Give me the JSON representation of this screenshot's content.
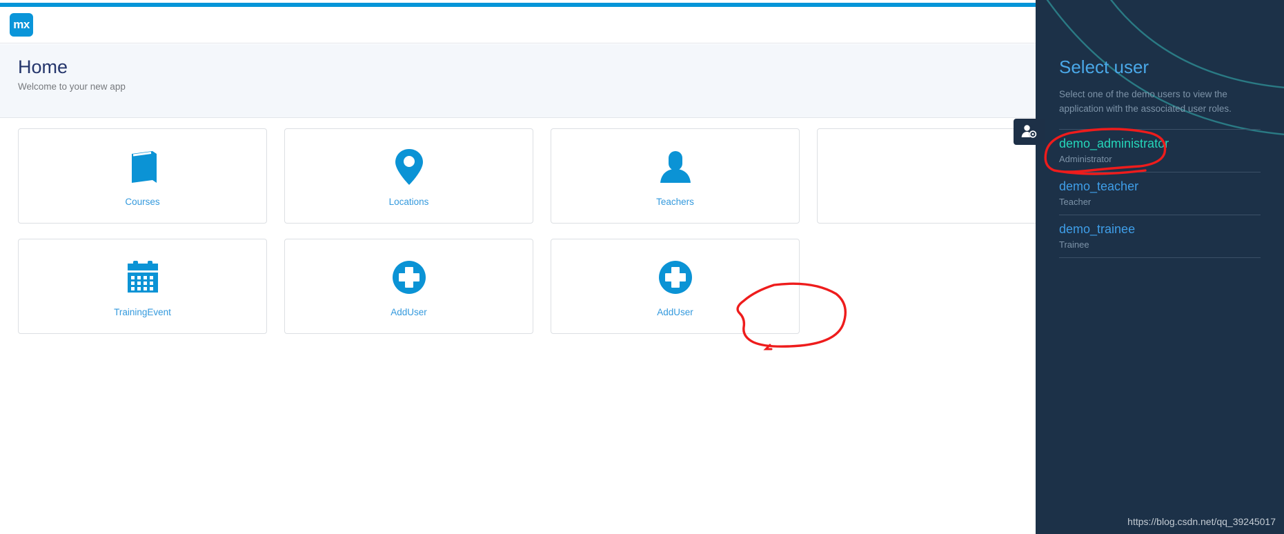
{
  "theme": {
    "accent_blue": "#0595d8",
    "tile_link_blue": "#3399dd",
    "sidebar_bg": "#1c3148",
    "sidebar_title_blue": "#4aa8e8",
    "active_user_teal": "#25d6ba",
    "annotation_red": "#ee1c1c",
    "page_title_navy": "#24356b"
  },
  "navbar": {
    "logo_text": "mx",
    "logo_icon": "mendix-logo-icon"
  },
  "header": {
    "title": "Home",
    "subtitle": "Welcome to your new app"
  },
  "user_tab": {
    "icon": "user-settings-icon",
    "label": ""
  },
  "tiles": {
    "row1": [
      {
        "label": "Courses",
        "icon": "book-icon"
      },
      {
        "label": "Locations",
        "icon": "map-pin-icon"
      },
      {
        "label": "Teachers",
        "icon": "person-icon"
      },
      {
        "label": "",
        "icon": ""
      }
    ],
    "row2": [
      {
        "label": "TrainingEvent",
        "icon": "calendar-icon"
      },
      {
        "label": "AddUser",
        "icon": "plus-circle-icon"
      },
      {
        "label": "AddUser",
        "icon": "plus-circle-icon"
      }
    ]
  },
  "sidebar": {
    "title": "Select user",
    "description": "Select one of the demo users to view the application with the associated user roles.",
    "users": [
      {
        "name": "demo_administrator",
        "role": "Administrator"
      },
      {
        "name": "demo_teacher",
        "role": "Teacher"
      },
      {
        "name": "demo_trainee",
        "role": "Trainee"
      }
    ]
  },
  "watermark": {
    "text": "https://blog.csdn.net/qq_39245017"
  }
}
